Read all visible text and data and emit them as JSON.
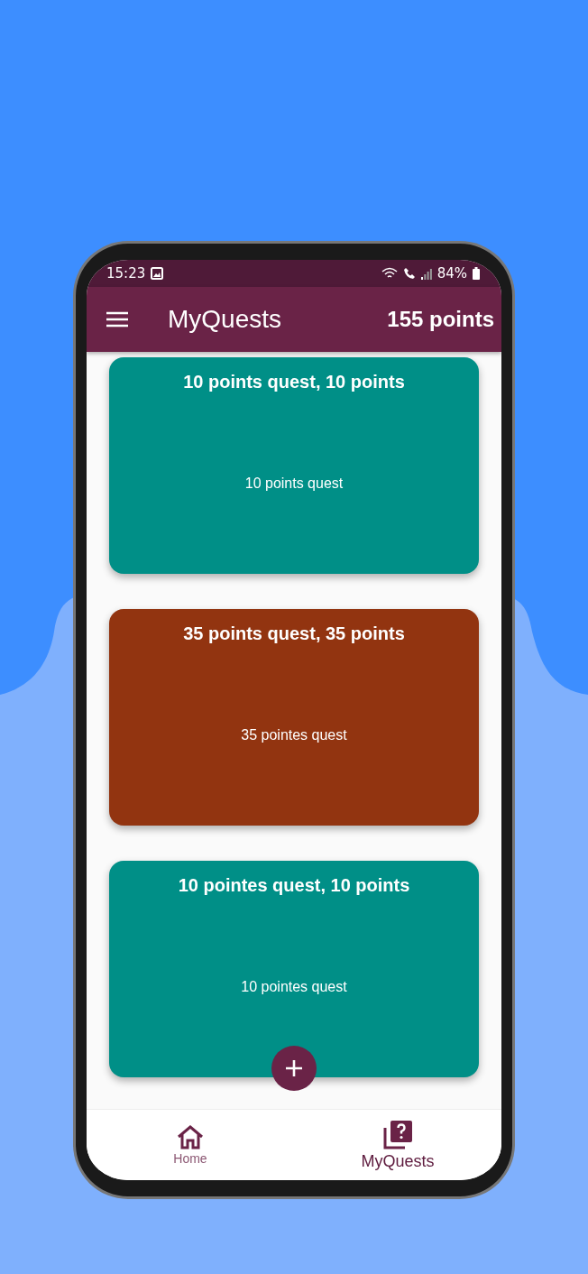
{
  "status_bar": {
    "time": "15:23",
    "battery": "84%"
  },
  "app_bar": {
    "title": "MyQuests",
    "points": "155 points"
  },
  "quests": [
    {
      "title": "10 points quest, 10 points",
      "description": "10 points quest",
      "color": "#008f87"
    },
    {
      "title": "35 points quest, 35 points",
      "description": "35 pointes quest",
      "color": "#923410"
    },
    {
      "title": "10 pointes quest, 10 points",
      "description": "10 pointes quest",
      "color": "#008f87"
    }
  ],
  "bottom_nav": [
    {
      "label": "Home",
      "kind": "home",
      "selected": false
    },
    {
      "label": "MyQuests",
      "kind": "quests",
      "selected": true
    }
  ]
}
